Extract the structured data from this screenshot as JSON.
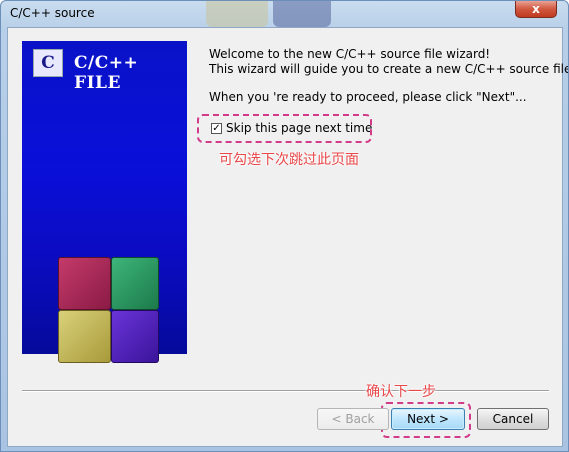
{
  "window": {
    "title": "C/C++ source",
    "close_label": "x"
  },
  "side_panel": {
    "logo_icon_text": "C",
    "logo_text": "C/C++ FILE"
  },
  "content": {
    "welcome_line1": "Welcome to the new C/C++ source file wizard!",
    "welcome_line2": "This wizard will guide you to create a new C/C++ source file.",
    "proceed_text": "When you 're ready to proceed, please click \"Next\"...",
    "skip_checkbox_label": "Skip this page next time",
    "skip_checked": true,
    "checkmark": "✓"
  },
  "annotations": {
    "checkbox_note": "可勾选下次跳过此页面",
    "next_note": "确认下一步"
  },
  "buttons": {
    "back_label": "< Back",
    "next_label": "Next >",
    "cancel_label": "Cancel"
  },
  "colors": {
    "annotation": "#e8484a",
    "annotation_border": "#d23a8a",
    "side_panel_bg": "#0a12c8"
  }
}
